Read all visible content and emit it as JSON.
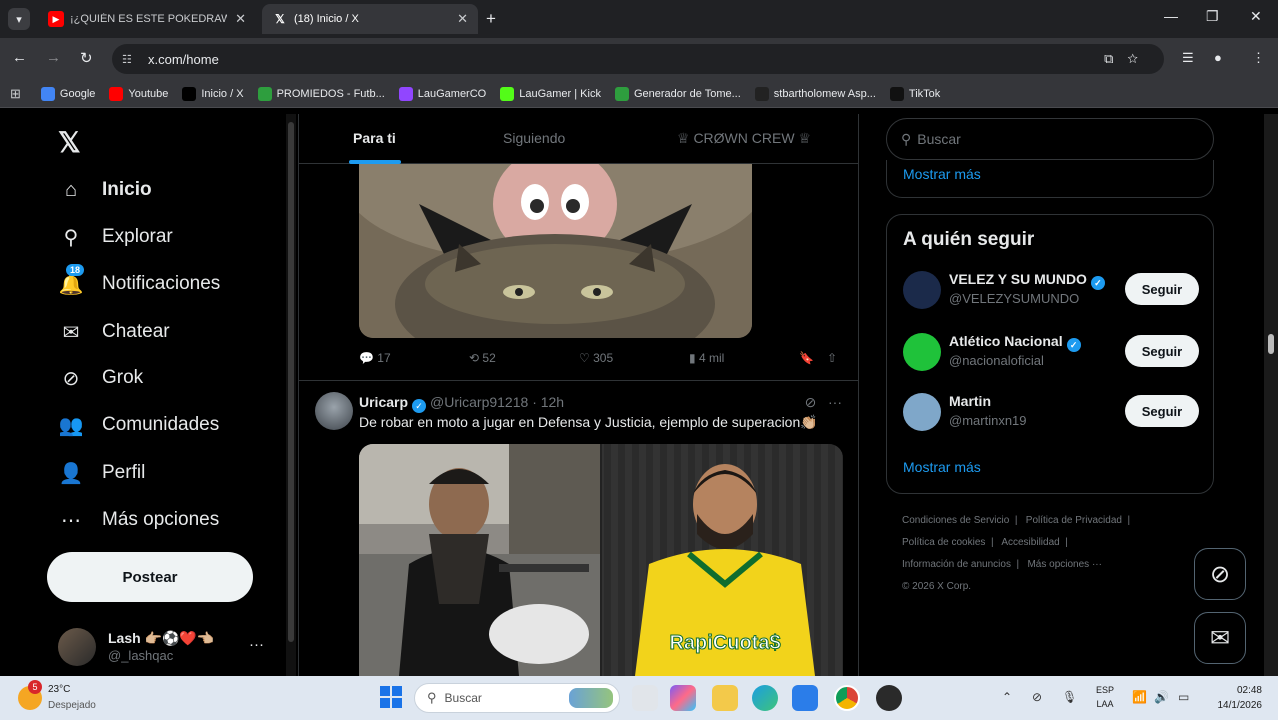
{
  "browser": {
    "tabs": [
      {
        "label": "¡¿QUIÉN ES ESTE POKEDRAWIT",
        "active": false
      },
      {
        "label": "(18) Inicio / X",
        "active": true
      }
    ],
    "url": "x.com/home",
    "bookmarks": [
      {
        "label": "Google",
        "icon": "google-icon",
        "color": "#4285f4"
      },
      {
        "label": "Youtube",
        "icon": "youtube-icon",
        "color": "#ff0000"
      },
      {
        "label": "Inicio / X",
        "icon": "x-icon",
        "color": "#000000"
      },
      {
        "label": "PROMIEDOS - Futb...",
        "icon": "promiedos-icon",
        "color": "#2e9e3e"
      },
      {
        "label": "LauGamerCO",
        "icon": "twitch-icon",
        "color": "#9146ff"
      },
      {
        "label": "LauGamer | Kick",
        "icon": "kick-icon",
        "color": "#53fc18"
      },
      {
        "label": "Generador de Tome...",
        "icon": "generator-icon",
        "color": "#2e9e3e"
      },
      {
        "label": "stbartholomew Asp...",
        "icon": "stbartholomew-icon",
        "color": "#222222"
      },
      {
        "label": "TikTok",
        "icon": "tiktok-icon",
        "color": "#111111"
      }
    ]
  },
  "x": {
    "nav": [
      {
        "label": "Inicio",
        "icon": "home-icon",
        "glyph": "⌂"
      },
      {
        "label": "Explorar",
        "icon": "search-icon",
        "glyph": "⚲"
      },
      {
        "label": "Notificaciones",
        "icon": "bell-icon",
        "glyph": "🔔",
        "badge": "18"
      },
      {
        "label": "Chatear",
        "icon": "mail-icon",
        "glyph": "✉"
      },
      {
        "label": "Grok",
        "icon": "grok-icon",
        "glyph": "⊘"
      },
      {
        "label": "Comunidades",
        "icon": "people-icon",
        "glyph": "👥"
      },
      {
        "label": "Perfil",
        "icon": "person-icon",
        "glyph": "👤"
      },
      {
        "label": "Más opciones",
        "icon": "more-circle-icon",
        "glyph": "⋯"
      }
    ],
    "post_button": "Postear",
    "account": {
      "name": "Lash 👉🏼⚽❤️👈🏼",
      "handle": "@_lashqac"
    },
    "feed_tabs": [
      "Para ti",
      "Siguiendo",
      "♕ CRØWN CREW ♕"
    ],
    "tweet1_actions": {
      "replies": "17",
      "reposts": "52",
      "likes": "305",
      "views": "4 mil"
    },
    "tweet2": {
      "name": "Uricarp",
      "handle": "@Uricarp91218",
      "time": "· 12h",
      "text": "De robar en moto a jugar en Defensa y Justicia, ejemplo de superacion👏🏼",
      "jersey_text": "RapiCuota$"
    },
    "search_placeholder": "Buscar",
    "show_more": "Mostrar más",
    "who_to_follow": {
      "title": "A quién seguir",
      "users": [
        {
          "name": "VELEZ Y SU MUNDO",
          "handle": "@VELEZYSUMUNDO",
          "verified": true,
          "avatar_color": "#1b2a4a"
        },
        {
          "name": "Atlético Nacional",
          "handle": "@nacionaloficial",
          "verified": true,
          "avatar_color": "#1fc23a"
        },
        {
          "name": "Martin",
          "handle": "@martinxn19",
          "verified": false,
          "avatar_color": "#7fa7c9"
        }
      ],
      "follow_label": "Seguir",
      "show_more": "Mostrar más"
    },
    "footer": [
      "Condiciones de Servicio",
      "Política de Privacidad",
      "Política de cookies",
      "Accesibilidad",
      "Información de anuncios",
      "Más opciones ···",
      "© 2026 X Corp."
    ]
  },
  "taskbar": {
    "weather_temp": "23°C",
    "weather_desc": "Despejado",
    "weather_badge": "5",
    "search_placeholder": "Buscar",
    "lang_line1": "ESP",
    "lang_line2": "LAA",
    "time": "02:48",
    "date": "14/1/2026"
  }
}
